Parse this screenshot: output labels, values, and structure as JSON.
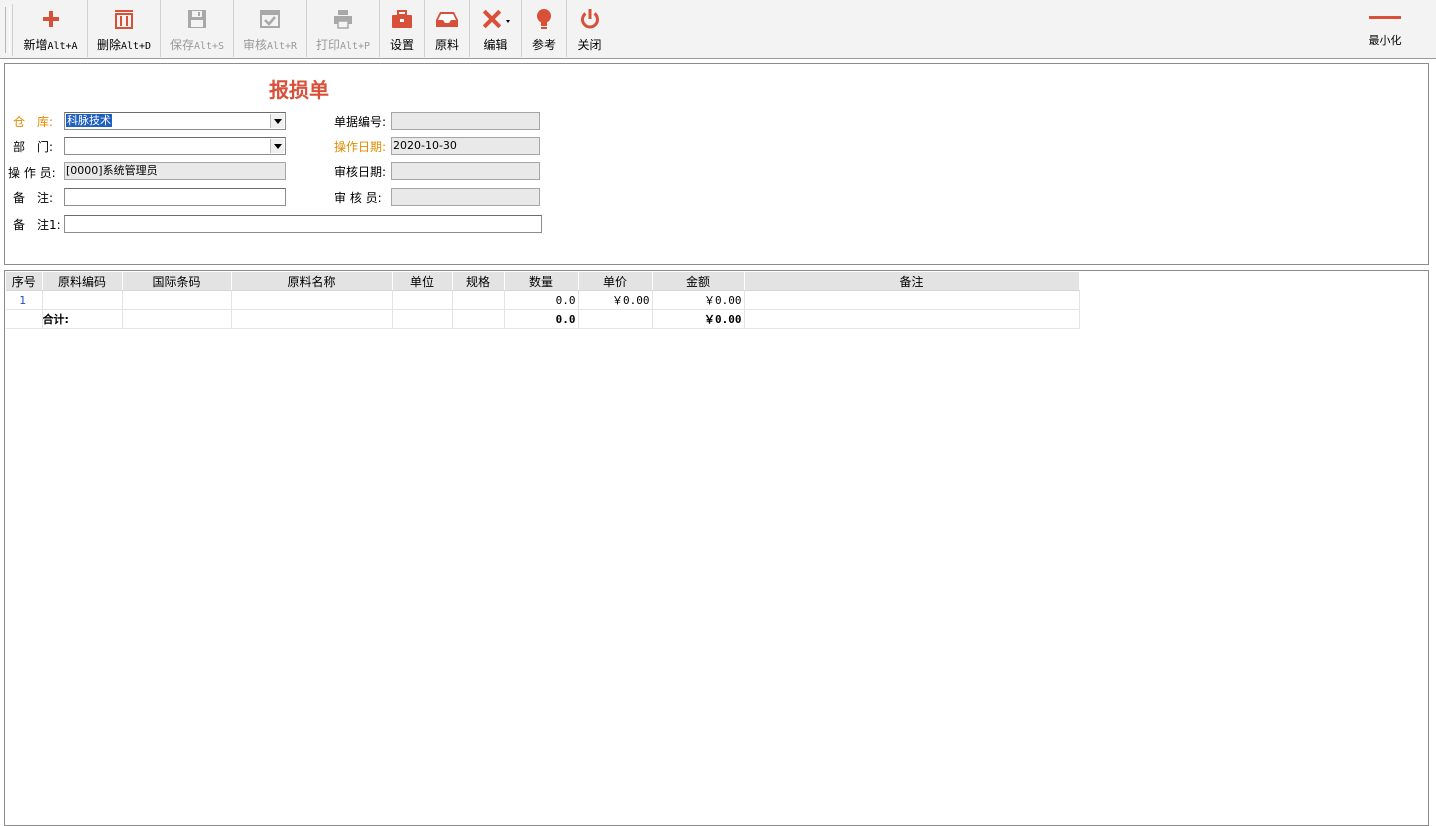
{
  "toolbar": {
    "add_label": "新增",
    "add_shortcut": "Alt+A",
    "delete_label": "删除",
    "delete_shortcut": "Alt+D",
    "save_label": "保存",
    "save_shortcut": "Alt+S",
    "audit_label": "审核",
    "audit_shortcut": "Alt+R",
    "print_label": "打印",
    "print_shortcut": "Alt+P",
    "settings_label": "设置",
    "material_label": "原料",
    "edit_label": "编辑",
    "reference_label": "参考",
    "close_label": "关闭",
    "minimize_label": "最小化"
  },
  "form": {
    "title": "报损单",
    "warehouse_label": "仓　库:",
    "warehouse_value": "科脉技术",
    "department_label": "部　门:",
    "department_value": "",
    "operator_label": "操 作 员:",
    "operator_value": "[0000]系统管理员",
    "remark_label": "备　注:",
    "remark_value": "",
    "remark1_label": "备　注1:",
    "remark1_value": "",
    "doc_no_label": "单据编号:",
    "doc_no_value": "",
    "op_date_label": "操作日期:",
    "op_date_value": "2020-10-30",
    "audit_date_label": "审核日期:",
    "audit_date_value": "",
    "auditor_label": "审 核 员:",
    "auditor_value": ""
  },
  "grid": {
    "headers": [
      "序号",
      "原料编码",
      "国际条码",
      "原料名称",
      "单位",
      "规格",
      "数量",
      "单价",
      "金额",
      "备注"
    ],
    "rows": [
      {
        "seq": "1",
        "code": "",
        "barcode": "",
        "name": "",
        "unit": "",
        "spec": "",
        "qty": "0.0",
        "price": "￥0.00",
        "amount": "￥0.00",
        "note": ""
      }
    ],
    "total": {
      "label": "合计:",
      "qty": "0.0",
      "amount": "￥0.00"
    }
  },
  "colors": {
    "accent": "#d9503a",
    "required_label": "#e08a00"
  }
}
